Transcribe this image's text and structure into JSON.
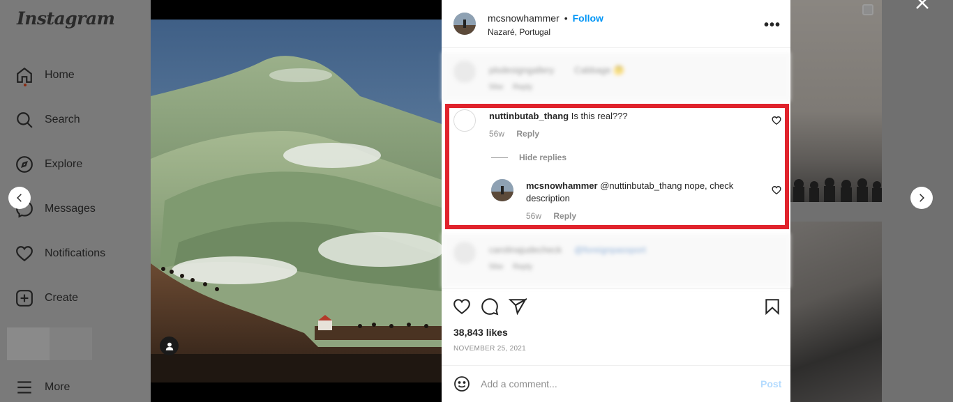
{
  "sidebar": {
    "logo": "Instagram",
    "items": [
      {
        "label": "Home",
        "icon": "home-icon"
      },
      {
        "label": "Search",
        "icon": "search-icon"
      },
      {
        "label": "Explore",
        "icon": "compass-icon"
      },
      {
        "label": "Messages",
        "icon": "messenger-icon"
      },
      {
        "label": "Notifications",
        "icon": "heart-icon"
      },
      {
        "label": "Create",
        "icon": "plus-square-icon"
      },
      {
        "label": "More",
        "icon": "hamburger-icon"
      }
    ]
  },
  "post": {
    "username": "mcsnowhammer",
    "separator": "•",
    "follow_label": "Follow",
    "location": "Nazaré, Portugal",
    "more_label": "•••"
  },
  "comments": {
    "blurred_top": {
      "user": "plsdesigngallery",
      "text": "Cabbage 🤔",
      "time": "56w",
      "reply": "Reply"
    },
    "highlighted": {
      "user": "nuttinbutab_thang",
      "text": "Is this real???",
      "time": "56w",
      "reply": "Reply",
      "hide_replies": "Hide replies",
      "reply_item": {
        "user": "mcsnowhammer",
        "text": "@nuttinbutab_thang nope, check description",
        "time": "56w",
        "reply": "Reply"
      }
    },
    "blurred_bottom": {
      "user": "carolinajudecheck",
      "text": "@foreignpassport",
      "time": "56w",
      "reply": "Reply"
    }
  },
  "footer": {
    "likes": "38,843 likes",
    "date": "NOVEMBER 25, 2021",
    "comment_placeholder": "Add a comment...",
    "post_label": "Post"
  },
  "colors": {
    "accent": "#0095f6",
    "highlight_border": "#e0232c",
    "post_disabled": "#b3dbff"
  }
}
